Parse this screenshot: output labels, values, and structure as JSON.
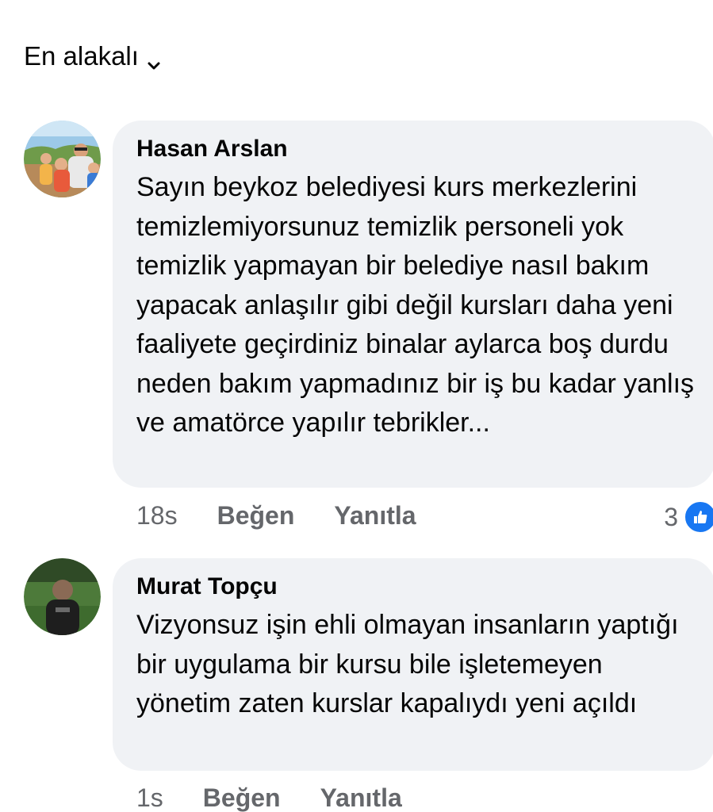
{
  "sort": {
    "label": "En alakalı"
  },
  "comments": [
    {
      "author": "Hasan Arslan",
      "text": "Sayın beykoz belediyesi kurs merkezlerini temizlemiyorsunuz temizlik personeli yok temizlik yapmayan bir belediye nasıl bakım yapacak anlaşılır gibi değil kursları daha yeni faaliyete geçirdiniz binalar aylarca boş durdu neden bakım yapmadınız bir iş bu kadar yanlış ve amatörce yapılır tebrikler...",
      "time": "18s",
      "like_label": "Beğen",
      "reply_label": "Yanıtla",
      "reaction_count": "3"
    },
    {
      "author": "Murat Topçu",
      "text": "Vizyonsuz işin ehli olmayan insanların yaptığı bir uygulama bir kursu bile işletemeyen yönetim zaten kurslar kapalıydı yeni açıldı",
      "time": "1s",
      "like_label": "Beğen",
      "reply_label": "Yanıtla"
    }
  ],
  "icons": {
    "sort_chevron": "chevron-down-icon",
    "reaction": "like-reaction-icon"
  },
  "colors": {
    "bubble": "#f0f2f5",
    "meta_text": "#65676b",
    "like_blue": "#1877f2"
  }
}
